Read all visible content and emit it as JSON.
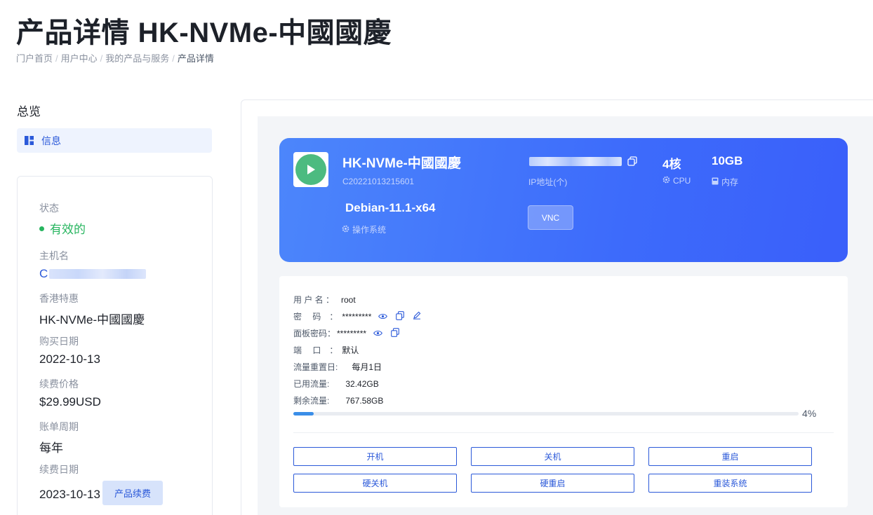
{
  "page": {
    "title": "产品详情 HK-NVMe-中國國慶",
    "breadcrumb": [
      "门户首页",
      "用户中心",
      "我的产品与服务",
      "产品详情"
    ]
  },
  "sidebar": {
    "overview_label": "总览",
    "menu": [
      {
        "label": "信息",
        "icon": "dashboard-icon",
        "active": true
      }
    ]
  },
  "info": {
    "status_label": "状态",
    "status_value": "有效的",
    "hostname_label": "主机名",
    "hostname_prefix": "C",
    "plan_label": "香港特惠",
    "plan_value": "HK-NVMe-中國國慶",
    "purchase_date_label": "购买日期",
    "purchase_date_value": "2022-10-13",
    "renew_price_label": "续费价格",
    "renew_price_value": "$29.99USD",
    "billing_cycle_label": "账单周期",
    "billing_cycle_value": "每年",
    "renew_date_label": "续费日期",
    "renew_date_value": "2023-10-13",
    "renew_button": "产品续费"
  },
  "server": {
    "name": "HK-NVMe-中國國慶",
    "id": "C20221013215601",
    "os": "Debian-11.1-x64",
    "os_label": "操作系统",
    "ip_label": "IP地址(个)",
    "vnc_button": "VNC",
    "cpu_value": "4核",
    "cpu_label": "CPU",
    "memory_value": "10GB",
    "memory_label": "内存",
    "status_color": "#4cbb80"
  },
  "details": {
    "username_label": "用 户 名 ：",
    "username_value": "root",
    "password_label": "密　 码　：",
    "password_value": "*********",
    "panel_password_label": "面板密码：",
    "panel_password_value": "*********",
    "port_label": "端　 口　：",
    "port_value": "默认",
    "traffic_reset_label": "流量重置日:",
    "traffic_reset_value": "每月1日",
    "used_traffic_label": "已用流量:",
    "used_traffic_value": "32.42GB",
    "remaining_traffic_label": "剩余流量:",
    "remaining_traffic_value": "767.58GB",
    "usage_percent_text": "4%",
    "usage_fraction": 0.04
  },
  "actions": {
    "power_on": "开机",
    "power_off": "关机",
    "restart": "重启",
    "hard_power_off": "硬关机",
    "hard_restart": "硬重启",
    "reinstall": "重装系统"
  },
  "colors": {
    "accent": "#2b59d9",
    "status_green": "#27b55f",
    "hero_gradient_start": "#4c86fb",
    "hero_gradient_end": "#3a5ffa",
    "progress": "#3a8ee8"
  }
}
